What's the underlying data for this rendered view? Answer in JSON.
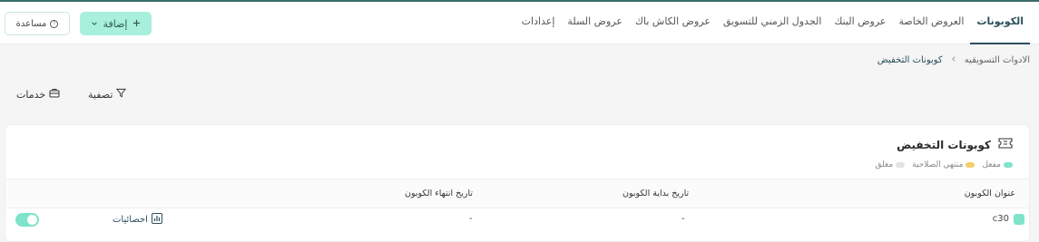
{
  "topbar": {
    "tabs": [
      {
        "label": "الكوبونات",
        "active": true
      },
      {
        "label": "العروض الخاصة"
      },
      {
        "label": "عروض البنك"
      },
      {
        "label": "الجدول الزمني للتسويق"
      },
      {
        "label": "عروض الكاش باك"
      },
      {
        "label": "عروض السلة"
      },
      {
        "label": "إعدادات"
      }
    ],
    "add_label": "إضافة",
    "help_label": "مساعدة"
  },
  "breadcrumb": {
    "parent": "الادوات التسويقيه",
    "current": "كوبونات التخفيض"
  },
  "toolbar": {
    "filter_label": "تصفية",
    "services_label": "خدمات"
  },
  "card": {
    "title": "كوبونات التخفيض",
    "legend": [
      {
        "label": "مفعل",
        "color": "#7ee3cb"
      },
      {
        "label": "منتهي الصلاحية",
        "color": "#f3cf6b"
      },
      {
        "label": "مغلق",
        "color": "#e3e3e3"
      }
    ],
    "columns": {
      "title": "عنوان الكوبون",
      "start": "تاريخ بداية الكوبون",
      "end": "تاريخ انتهاء الكوبون"
    },
    "rows": [
      {
        "code": "c30",
        "start": "-",
        "end": "-",
        "stats_label": "احصائيات",
        "enabled": true
      }
    ]
  },
  "colors": {
    "accent": "#a8f0dc",
    "active_tab": "#2a4f5a",
    "enabled": "#7ee3cb"
  }
}
